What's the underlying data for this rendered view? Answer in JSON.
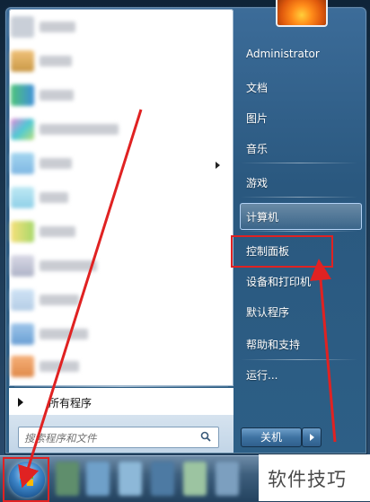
{
  "left_pane": {
    "all_programs_label": "所有程序",
    "search_placeholder": "搜索程序和文件"
  },
  "right_pane": {
    "items": [
      {
        "label": "Administrator"
      },
      {
        "label": "文档"
      },
      {
        "label": "图片"
      },
      {
        "label": "音乐"
      },
      {
        "label": "游戏"
      },
      {
        "label": "计算机"
      },
      {
        "label": "控制面板"
      },
      {
        "label": "设备和打印机"
      },
      {
        "label": "默认程序"
      },
      {
        "label": "帮助和支持"
      },
      {
        "label": "运行..."
      }
    ]
  },
  "shutdown": {
    "label": "关机"
  },
  "watermark": {
    "text": "软件技巧"
  },
  "colors": {
    "annotation_red": "#e02222",
    "menu_blue": "#2d5f86"
  }
}
